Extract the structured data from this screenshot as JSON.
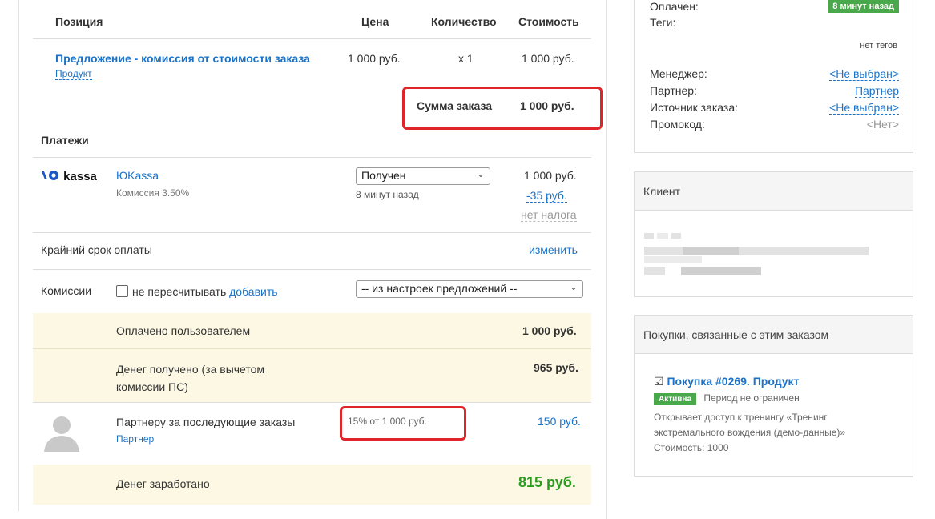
{
  "order_table": {
    "headers": {
      "position": "Позиция",
      "price": "Цена",
      "quantity": "Количество",
      "cost": "Стоимость"
    },
    "item": {
      "title": "Предложение - комиссия от стоимости заказа",
      "type": "Продукт",
      "price": "1 000 руб.",
      "quantity": "x 1",
      "cost": "1 000 руб."
    },
    "total_label": "Сумма заказа",
    "total_value": "1 000 руб."
  },
  "payments": {
    "section_title": "Платежи",
    "provider_logo": "kassa",
    "provider_name": "ЮKassa",
    "commission": "Комиссия 3.50%",
    "status": "Получен",
    "status_time": "8 минут назад",
    "amount": "1 000 руб.",
    "fee": "-35 руб.",
    "tax": "нет налога"
  },
  "deadline": {
    "label": "Крайний срок оплаты",
    "action": "изменить"
  },
  "commissions": {
    "label": "Комиссии",
    "checkbox_label": "не пересчитывать",
    "add_link": "добавить",
    "select_value": "-- из настроек предложений --"
  },
  "summary": {
    "paid_label": "Оплачено пользователем",
    "paid_value": "1 000 руб.",
    "received_label_1": "Денег получено (за вычетом",
    "received_label_2": "комиссии ПС)",
    "received_value": "965 руб.",
    "partner_label": "Партнеру за последующие заказы",
    "partner_role": "Партнер",
    "partner_calc": "15% от 1 000 руб.",
    "partner_value": "150 руб.",
    "earned_label": "Денег заработано",
    "earned_value": "815 руб."
  },
  "order_info": {
    "paid_label": "Оплачен:",
    "paid_badge": "8 минут назад",
    "tags_label": "Теги:",
    "tags_value": "нет тегов",
    "manager_label": "Менеджер:",
    "manager_value": "<Не выбран>",
    "partner_label": "Партнер:",
    "partner_value": "Партнер",
    "source_label": "Источник заказа:",
    "source_value": "<Не выбран>",
    "promo_label": "Промокод:",
    "promo_value": "<Нет>"
  },
  "client": {
    "title": "Клиент"
  },
  "purchases": {
    "title": "Покупки, связанные с этим заказом",
    "link": "Покупка #0269. Продукт",
    "status": "Активна",
    "period": "Период не ограничен",
    "desc_1": "Открывает доступ к тренингу «Тренинг",
    "desc_2": "экстремального вождения (демо-данные)»",
    "cost": "Стоимость: 1000"
  },
  "colors": {
    "link": "#1a73c9",
    "highlight": "#e0252a",
    "beige": "#fcf8e3",
    "green": "#48a84a",
    "earned": "#2a9d1f"
  }
}
